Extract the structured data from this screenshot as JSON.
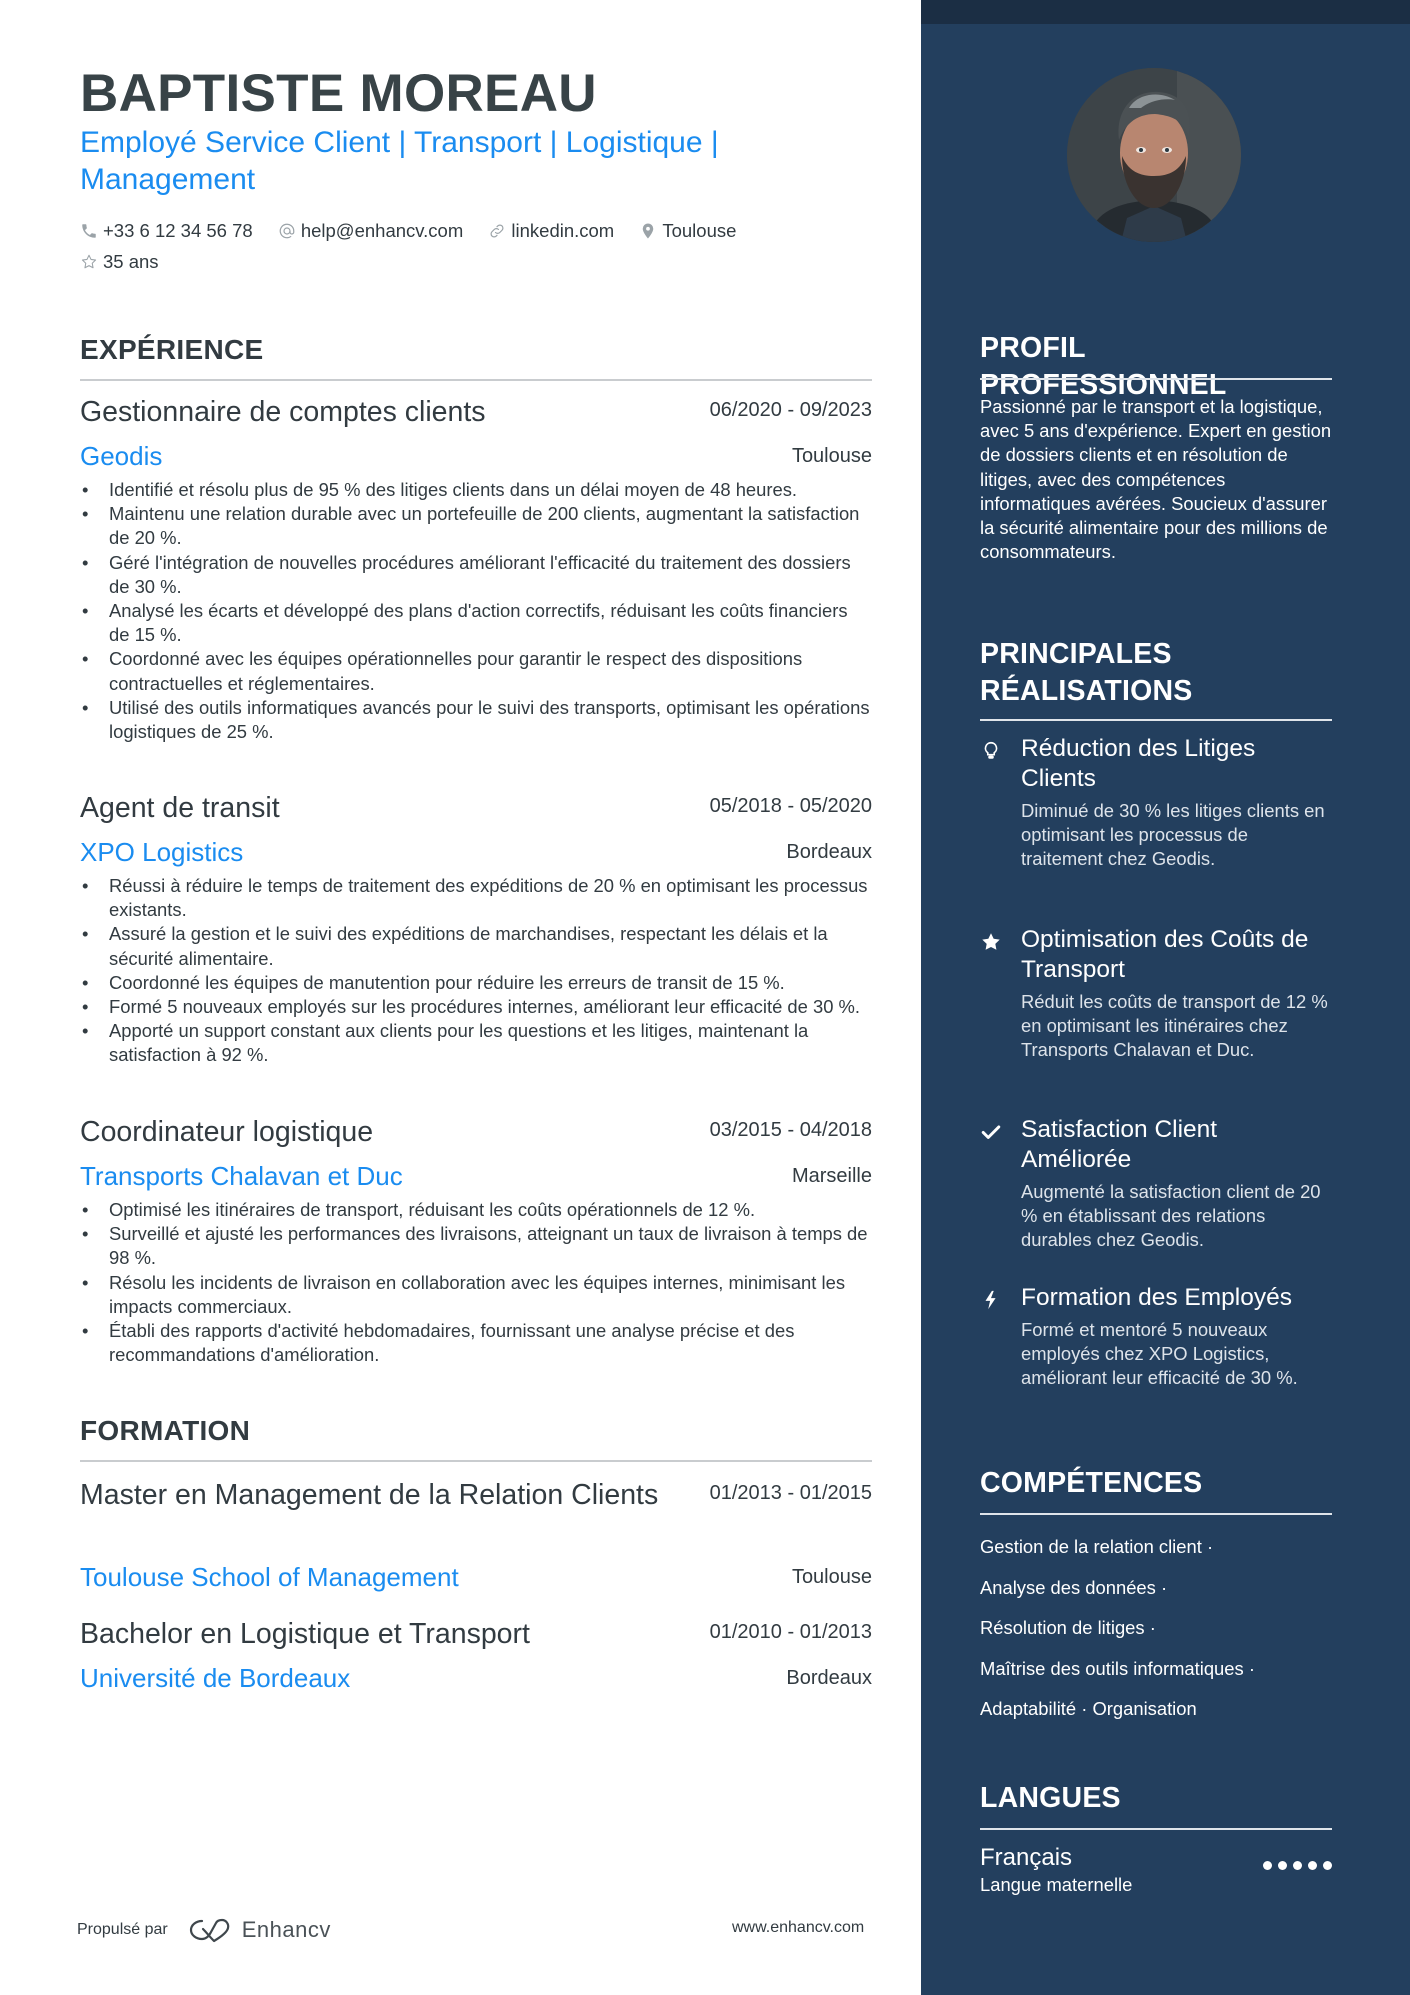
{
  "header": {
    "name": "BAPTISTE MOREAU",
    "subtitle": "Employé Service Client | Transport | Logistique | Management",
    "contacts": [
      {
        "icon": "phone-icon",
        "text": "+33 6 12 34 56 78"
      },
      {
        "icon": "at-icon",
        "text": "help@enhancv.com"
      },
      {
        "icon": "link-icon",
        "text": "linkedin.com"
      },
      {
        "icon": "location-icon",
        "text": "Toulouse"
      },
      {
        "icon": "star-outline-icon",
        "text": "35 ans"
      }
    ]
  },
  "experience": {
    "title": "EXPÉRIENCE",
    "entries": [
      {
        "role": "Gestionnaire de comptes clients",
        "dates": "06/2020 - 09/2023",
        "company": "Geodis",
        "location": "Toulouse",
        "bullets": [
          "Identifié et résolu plus de 95 % des litiges clients dans un délai moyen de 48 heures.",
          "Maintenu une relation durable avec un portefeuille de 200 clients, augmentant la satisfaction de 20 %.",
          "Géré l'intégration de nouvelles procédures améliorant l'efficacité du traitement des dossiers de 30 %.",
          "Analysé les écarts et développé des plans d'action correctifs, réduisant les coûts financiers de 15 %.",
          "Coordonné avec les équipes opérationnelles pour garantir le respect des dispositions contractuelles et réglementaires.",
          "Utilisé des outils informatiques avancés pour le suivi des transports, optimisant les opérations logistiques de 25 %."
        ]
      },
      {
        "role": "Agent de transit",
        "dates": "05/2018 - 05/2020",
        "company": "XPO Logistics",
        "location": "Bordeaux",
        "bullets": [
          "Réussi à réduire le temps de traitement des expéditions de 20 % en optimisant les processus existants.",
          "Assuré la gestion et le suivi des expéditions de marchandises, respectant les délais et la sécurité alimentaire.",
          "Coordonné les équipes de manutention pour réduire les erreurs de transit de 15 %.",
          "Formé 5 nouveaux employés sur les procédures internes, améliorant leur efficacité de 30 %.",
          "Apporté un support constant aux clients pour les questions et les litiges, maintenant la satisfaction à 92 %."
        ]
      },
      {
        "role": "Coordinateur logistique",
        "dates": "03/2015 - 04/2018",
        "company": "Transports Chalavan et Duc",
        "location": "Marseille",
        "bullets": [
          "Optimisé les itinéraires de transport, réduisant les coûts opérationnels de 12 %.",
          "Surveillé et ajusté les performances des livraisons, atteignant un taux de livraison à temps de 98 %.",
          "Résolu les incidents de livraison en collaboration avec les équipes internes, minimisant les impacts commerciaux.",
          "Établi des rapports d'activité hebdomadaires, fournissant une analyse précise et des recommandations d'amélioration."
        ]
      }
    ]
  },
  "education": {
    "title": "FORMATION",
    "entries": [
      {
        "degree": "Master en Management de la Relation Clients",
        "dates": "01/2013 - 01/2015",
        "school": "Toulouse School of Management",
        "location": "Toulouse"
      },
      {
        "degree": "Bachelor en Logistique et Transport",
        "dates": "01/2010 - 01/2013",
        "school": "Université de Bordeaux",
        "location": "Bordeaux"
      }
    ]
  },
  "footer": {
    "powered_by": "Propulsé par",
    "brand": "Enhancv",
    "url": "www.enhancv.com"
  },
  "sidebar": {
    "photo_alt": "Portrait of Baptiste Moreau",
    "profile": {
      "title": "PROFIL PROFESSIONNEL",
      "text": "Passionné par le transport et la logistique, avec 5 ans d'expérience. Expert en gestion de dossiers clients et en résolution de litiges, avec des compétences informatiques avérées. Soucieux d'assurer la sécurité alimentaire pour des millions de consommateurs."
    },
    "achievements": {
      "title": "PRINCIPALES RÉALISATIONS",
      "items": [
        {
          "icon": "lightbulb-icon",
          "title": "Réduction des Litiges Clients",
          "desc": "Diminué de 30 % les litiges clients en optimisant les processus de traitement chez Geodis."
        },
        {
          "icon": "star-icon",
          "title": "Optimisation des Coûts de Transport",
          "desc": "Réduit les coûts de transport de 12 % en optimisant les itinéraires chez Transports Chalavan et Duc."
        },
        {
          "icon": "checkmark-icon",
          "title": "Satisfaction Client Améliorée",
          "desc": "Augmenté la satisfaction client de 20 % en établissant des relations durables chez Geodis."
        },
        {
          "icon": "lightning-icon",
          "title": "Formation des Employés",
          "desc": "Formé et mentoré 5 nouveaux employés chez XPO Logistics, améliorant leur efficacité de 30 %."
        }
      ]
    },
    "skills": {
      "title": "COMPÉTENCES",
      "lines": [
        "Gestion de la relation client ·",
        "Analyse des données ·",
        "Résolution de litiges ·",
        "Maîtrise des outils informatiques ·",
        "Adaptabilité · Organisation"
      ]
    },
    "languages": {
      "title": "LANGUES",
      "items": [
        {
          "name": "Français",
          "level": "Langue maternelle",
          "rating": 5,
          "max": 5
        }
      ]
    }
  },
  "colors": {
    "accent": "#1a8cf0",
    "text": "#323b41",
    "sidebar_bg": "#233f5e",
    "sidebar_strip": "#1b2e44"
  }
}
